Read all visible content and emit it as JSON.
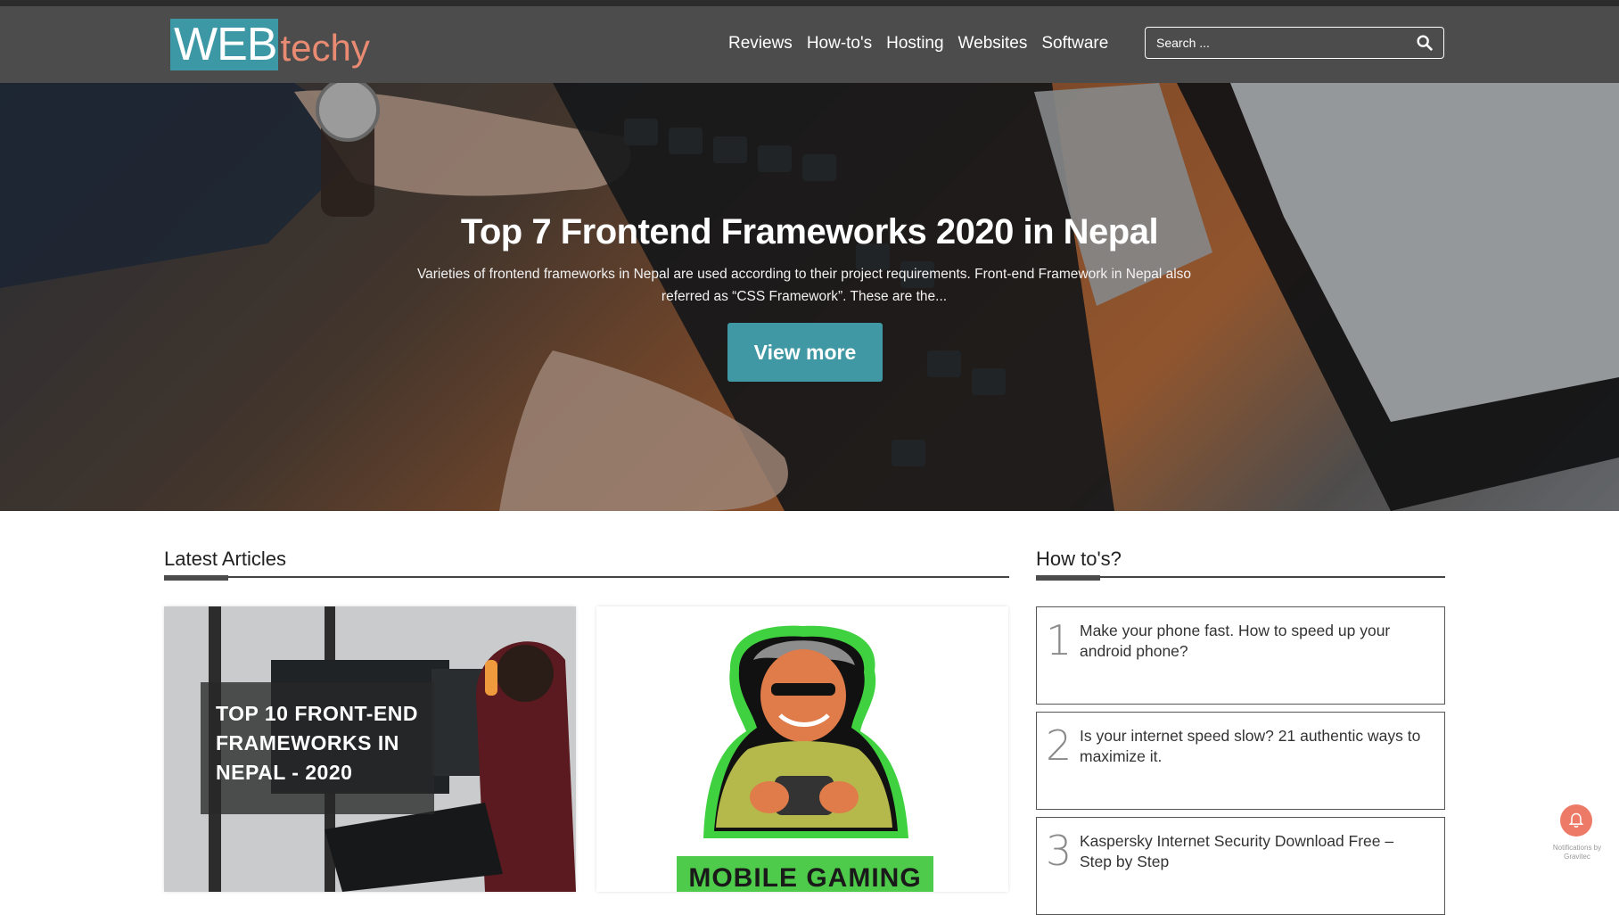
{
  "site": {
    "logo_primary": "WEB",
    "logo_secondary": "techy"
  },
  "nav": {
    "items": [
      {
        "label": "Reviews"
      },
      {
        "label": "How-to's"
      },
      {
        "label": "Hosting"
      },
      {
        "label": "Websites"
      },
      {
        "label": "Software"
      }
    ]
  },
  "search": {
    "placeholder": "Search ..."
  },
  "hero": {
    "title": "Top 7 Frontend Frameworks 2020 in Nepal",
    "description": "Varieties of frontend frameworks in Nepal are used according to their project requirements. Front-end Framework in Nepal also referred as “CSS Framework”. These are the...",
    "button_label": "View more"
  },
  "latest": {
    "heading": "Latest Articles",
    "cards": [
      {
        "thumb_text": "TOP 10 FRONT-END FRAMEWORKS IN NEPAL - 2020"
      },
      {
        "thumb_text": "MOBILE GAMING"
      }
    ]
  },
  "howtos": {
    "heading": "How to's?",
    "items": [
      {
        "number": "1",
        "title": "Make your phone fast. How to speed up your android phone?"
      },
      {
        "number": "2",
        "title": "Is your internet speed slow? 21 authentic ways to maximize it."
      },
      {
        "number": "3",
        "title": "Kaspersky Internet Security Download Free – Step by Step"
      }
    ]
  },
  "notification": {
    "label": "Notifications by Gravitec"
  },
  "colors": {
    "header_bg": "#4b4c4b",
    "accent_teal": "#3f98a3",
    "logo_orange": "#e98b73",
    "notif_orange": "#ec7a66"
  }
}
